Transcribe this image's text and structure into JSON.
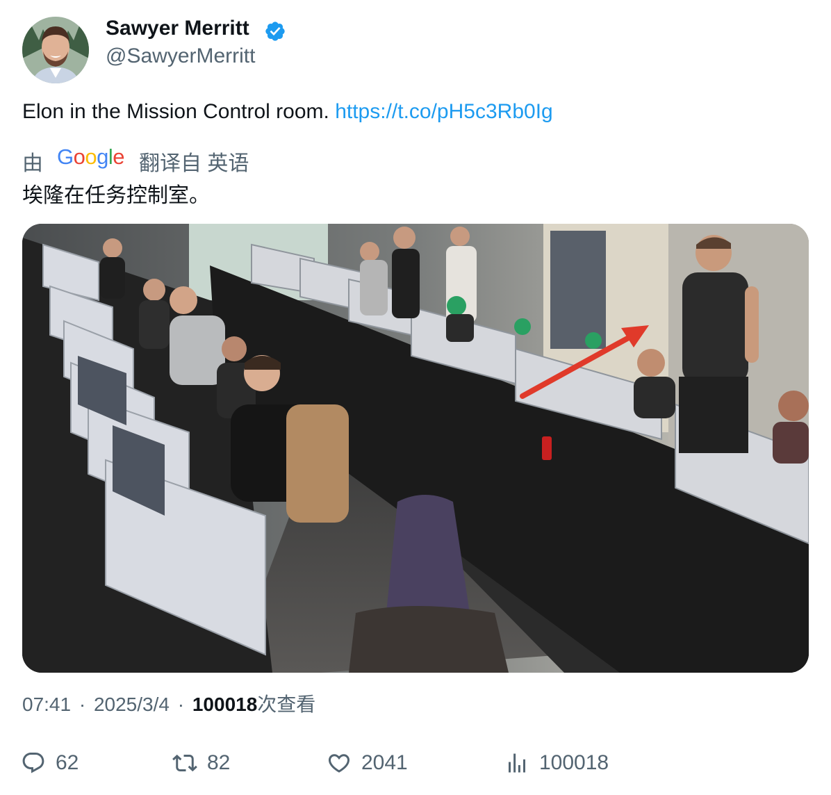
{
  "author": {
    "name": "Sawyer Merritt",
    "handle": "@SawyerMerritt",
    "verified": true,
    "verified_color": "#1d9bf0"
  },
  "tweet": {
    "text": "Elon in the Mission Control room.",
    "link": "https://t.co/pH5c3Rb0Ig",
    "link_color": "#1d9bf0"
  },
  "translation": {
    "by_label": "由",
    "google_letters": [
      "G",
      "o",
      "o",
      "g",
      "l",
      "e"
    ],
    "from_label": "翻译自 英语",
    "text": "埃隆在任务控制室。"
  },
  "media": {
    "icon": "photo-mission-control"
  },
  "meta": {
    "time": "07:41",
    "separator": "·",
    "date": "2025/3/4",
    "views_count": "100018",
    "views_label": "次查看"
  },
  "actions": {
    "replies": "62",
    "retweets": "82",
    "likes": "2041",
    "views": "100018"
  },
  "colors": {
    "text": "#0f1419",
    "secondary": "#536471",
    "accent": "#1d9bf0"
  }
}
